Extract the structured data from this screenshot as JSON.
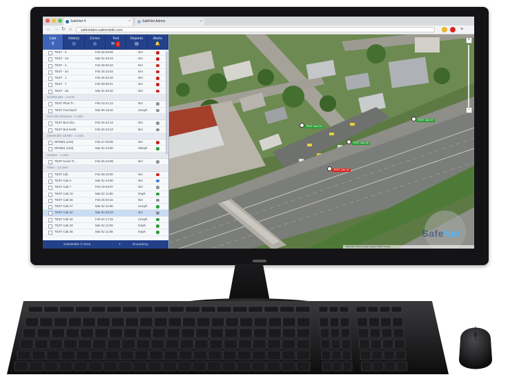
{
  "browser": {
    "tabs": [
      {
        "title": "SafeNet 4"
      },
      {
        "title": "SafeNet Admin"
      }
    ],
    "url": "safenetdev.safemobile.com"
  },
  "sidebar": {
    "nav_tabs": [
      {
        "label": "Live",
        "icon": "pin-icon"
      },
      {
        "label": "History",
        "icon": "clock-icon"
      },
      {
        "label": "Zones",
        "icon": "zone-icon"
      },
      {
        "label": "Text",
        "icon": "message-icon",
        "badge": "2"
      },
      {
        "label": "Reports",
        "icon": "report-icon"
      },
      {
        "label": "Alerts",
        "icon": "bell-icon"
      }
    ],
    "rows": [
      {
        "kind": "unit",
        "name": "TEST - 5",
        "date": "Feb 28 09:08",
        "speed": "N/A",
        "status": "red"
      },
      {
        "kind": "unit",
        "name": "TEST - 43",
        "date": "Mar 01 03:43",
        "speed": "N/A",
        "status": "red"
      },
      {
        "kind": "unit",
        "name": "TEST - 2",
        "date": "Feb 28 00:10",
        "speed": "N/A",
        "status": "red"
      },
      {
        "kind": "unit",
        "name": "TEST - 44",
        "date": "Feb 26 22:04",
        "speed": "N/A",
        "status": "red"
      },
      {
        "kind": "unit",
        "name": "TEST - 1",
        "date": "Feb 26 23:10",
        "speed": "N/A",
        "status": "red"
      },
      {
        "kind": "unit",
        "name": "TEST - 7",
        "date": "Feb 28 09:41",
        "speed": "N/A",
        "status": "red"
      },
      {
        "kind": "unit",
        "name": "TEST - 28",
        "date": "Mar 01 03:10",
        "speed": "N/A",
        "status": "red"
      },
      {
        "kind": "group",
        "label": "Northbrooke - 2 units"
      },
      {
        "kind": "unit",
        "name": "TEST Plow Tr...",
        "date": "Feb 24 21:12",
        "speed": "N/A",
        "status": "grey"
      },
      {
        "kind": "unit",
        "name": "TEST Fuel Bach",
        "date": "Mar 06 18:10",
        "speed": "41mph",
        "status": "grey"
      },
      {
        "kind": "group",
        "label": "Rest OB Industries - 2 units"
      },
      {
        "kind": "unit",
        "name": "TEST Bus Hbr...",
        "date": "Feb 26 22:13",
        "speed": "N/A",
        "status": "grey"
      },
      {
        "kind": "unit",
        "name": "TEST Bus Keith",
        "date": "Feb 26 22:13",
        "speed": "N/A",
        "status": "grey"
      },
      {
        "kind": "group",
        "label": "SafeMobile CB/MO - 2 units"
      },
      {
        "kind": "unit",
        "name": "DP4801 (102)",
        "date": "Feb 27 20:05",
        "speed": "N/A",
        "status": "red"
      },
      {
        "kind": "unit",
        "name": "DP4801 (103)",
        "date": "Mar 02 13:00",
        "speed": "38mph",
        "status": "green"
      },
      {
        "kind": "group",
        "label": "Stratton - 1 units"
      },
      {
        "kind": "unit",
        "name": "TEST Kevin Tr...",
        "date": "Feb 26 22:08",
        "speed": "N/A",
        "status": "grey"
      },
      {
        "kind": "group",
        "label": "Valleo - 13 units"
      },
      {
        "kind": "unit",
        "name": "TEST 14b",
        "date": "Feb 28 10:00",
        "speed": "N/A",
        "status": "red"
      },
      {
        "kind": "unit",
        "name": "TEST Cab 4",
        "date": "Mar 02 13:00",
        "speed": "N/A",
        "status": "blue"
      },
      {
        "kind": "unit",
        "name": "TEST Cab 7",
        "date": "Feb 19 03:07",
        "speed": "N/A",
        "status": "grey"
      },
      {
        "kind": "unit",
        "name": "TEST Cab 10",
        "date": "Mar 02 11:08",
        "speed": "0mph",
        "status": "green"
      },
      {
        "kind": "unit",
        "name": "TEST Cab 26",
        "date": "Feb 25 03:16",
        "speed": "N/A",
        "status": "grey"
      },
      {
        "kind": "unit",
        "name": "TEST Cab 37",
        "date": "Mar 02 11:09",
        "speed": "41mph",
        "status": "green"
      },
      {
        "kind": "unit",
        "name": "TEST Cab 40",
        "date": "Mar 02 00:23",
        "speed": "N/A",
        "status": "grey",
        "selected": true
      },
      {
        "kind": "unit",
        "name": "TEST Cab 32",
        "date": "Feb 02 17:15",
        "speed": "21mph",
        "status": "green"
      },
      {
        "kind": "unit",
        "name": "TEST Cab 33",
        "date": "Mar 02 11:09",
        "speed": "0mph",
        "status": "green"
      },
      {
        "kind": "unit",
        "name": "TEST Cab 36",
        "date": "Mar 02 11:08",
        "speed": "0mph",
        "status": "green"
      }
    ],
    "footer": {
      "copyright": "SafeMobile © 2015",
      "count": "7",
      "user": "shumphrey"
    }
  },
  "map": {
    "brand": "SafeNet",
    "brand_faint": "Safe",
    "brand_accent": "Net",
    "attribution": "Map data ©2015 Google  Imagery ©2015 Google",
    "markers": [
      {
        "label": "TEST Cab 10",
        "color": "#2e9c3a"
      },
      {
        "label": "TEST Cab 32",
        "color": "#2e9c3a"
      },
      {
        "label": "TEST Cab 37",
        "color": "#2e9c3a"
      },
      {
        "label": "TEST Cab 40",
        "color": "#d9261c"
      }
    ]
  },
  "colors": {
    "header_blue": "#23418a",
    "active_tab": "#3e64b9",
    "status_red": "#c8231c",
    "status_green": "#2c9a3a",
    "status_grey": "#8a8f98",
    "status_blue": "#3a7fd6"
  }
}
